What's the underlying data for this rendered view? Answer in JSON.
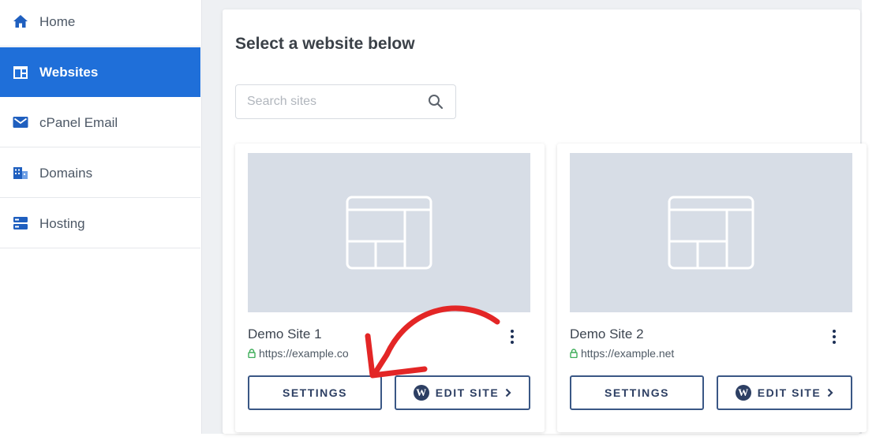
{
  "sidebar": {
    "items": [
      {
        "label": "Home",
        "icon": "home-icon"
      },
      {
        "label": "Websites",
        "icon": "websites-icon",
        "active": true
      },
      {
        "label": "cPanel Email",
        "icon": "mail-icon"
      },
      {
        "label": "Domains",
        "icon": "domains-icon"
      },
      {
        "label": "Hosting",
        "icon": "server-icon"
      }
    ]
  },
  "main": {
    "title": "Select a website below",
    "search": {
      "placeholder": "Search sites",
      "value": ""
    },
    "sites": [
      {
        "name": "Demo Site 1",
        "url": "https://example.co",
        "settings_label": "SETTINGS",
        "edit_label": "EDIT SITE"
      },
      {
        "name": "Demo Site 2",
        "url": "https://example.net",
        "settings_label": "SETTINGS",
        "edit_label": "EDIT SITE"
      }
    ]
  },
  "colors": {
    "accent": "#1f6fd9",
    "nav_icon": "#1f5fbf",
    "button_border": "#3a5785",
    "url_green": "#3fae5a",
    "annotation_red": "#e32626",
    "thumbnail": "#d7dde6"
  }
}
